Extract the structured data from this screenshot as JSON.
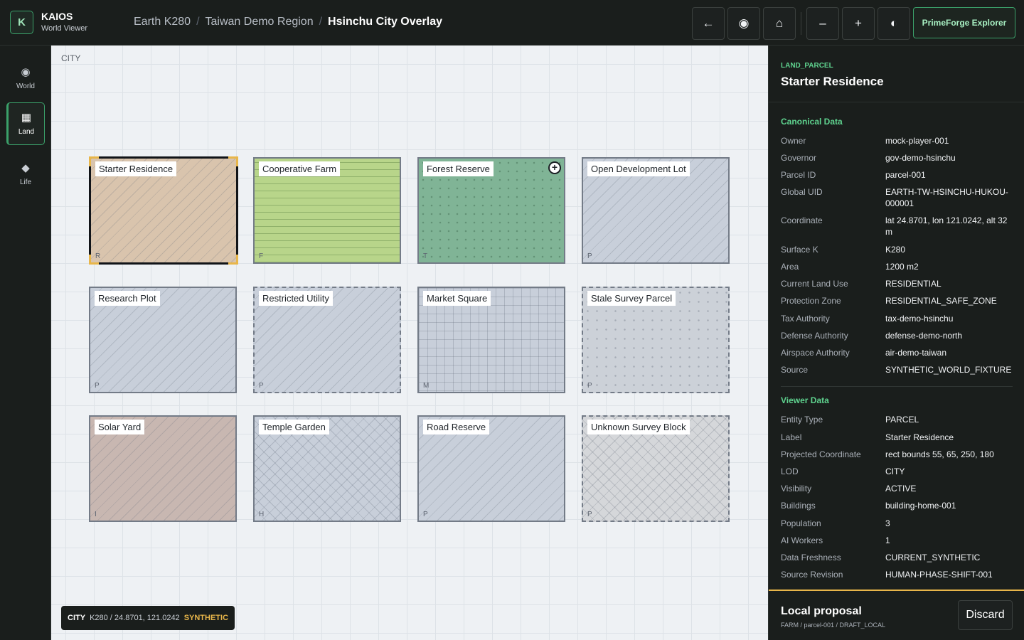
{
  "app": {
    "logo_letter": "K",
    "name": "KAIOS",
    "subtitle": "World Viewer"
  },
  "breadcrumb": [
    "Earth K280",
    "Taiwan Demo Region",
    "Hsinchu City Overlay"
  ],
  "toolbar": {
    "back_icon": "←",
    "target_icon": "◉",
    "home_icon": "⌂",
    "zoom_out_icon": "–",
    "zoom_in_icon": "+",
    "contrast_icon": "◐",
    "explorer_label": "PrimeForge Explorer"
  },
  "nav": [
    {
      "icon": "◉",
      "label": "World"
    },
    {
      "icon": "▦",
      "label": "Land"
    },
    {
      "icon": "◆",
      "label": "Life"
    }
  ],
  "canvas": {
    "lod_label": "CITY"
  },
  "parcels": [
    {
      "name": "Starter Residence",
      "code": "R",
      "color": "#d9c4ad",
      "selected": true
    },
    {
      "name": "Cooperative Farm",
      "code": "F",
      "color": "#b8d58a"
    },
    {
      "name": "Forest Reserve",
      "code": "T",
      "color": "#80b496",
      "badge": "+"
    },
    {
      "name": "Open Development Lot",
      "code": "P",
      "color": "#c8cfda"
    },
    {
      "name": "Research Plot",
      "code": "P",
      "color": "#c8cfda"
    },
    {
      "name": "Restricted Utility",
      "code": "P",
      "color": "#c8cfda"
    },
    {
      "name": "Market Square",
      "code": "M",
      "color": "#c8cfda"
    },
    {
      "name": "Stale Survey Parcel",
      "code": "P",
      "color": "#ccd1d8"
    },
    {
      "name": "Solar Yard",
      "code": "I",
      "color": "#c8b7b1"
    },
    {
      "name": "Temple Garden",
      "code": "H",
      "color": "#c8cfda"
    },
    {
      "name": "Road Reserve",
      "code": "P",
      "color": "#c8cfda"
    },
    {
      "name": "Unknown Survey Block",
      "code": "P",
      "color": "#d5d7da"
    }
  ],
  "status": {
    "lod": "CITY",
    "coords": "K280 / 24.8701, 121.0242",
    "tag": "SYNTHETIC"
  },
  "inspector": {
    "kind": "LAND_PARCEL",
    "title": "Starter Residence",
    "canonical_title": "Canonical Data",
    "canonical": [
      {
        "k": "Owner",
        "v": "mock-player-001"
      },
      {
        "k": "Governor",
        "v": "gov-demo-hsinchu"
      },
      {
        "k": "Parcel ID",
        "v": "parcel-001"
      },
      {
        "k": "Global UID",
        "v": "EARTH-TW-HSINCHU-HUKOU-000001"
      },
      {
        "k": "Coordinate",
        "v": "lat 24.8701, lon 121.0242, alt 32 m"
      },
      {
        "k": "Surface K",
        "v": "K280"
      },
      {
        "k": "Area",
        "v": "1200 m2"
      },
      {
        "k": "Current Land Use",
        "v": "RESIDENTIAL"
      },
      {
        "k": "Protection Zone",
        "v": "RESIDENTIAL_SAFE_ZONE"
      },
      {
        "k": "Tax Authority",
        "v": "tax-demo-hsinchu"
      },
      {
        "k": "Defense Authority",
        "v": "defense-demo-north"
      },
      {
        "k": "Airspace Authority",
        "v": "air-demo-taiwan"
      },
      {
        "k": "Source",
        "v": "SYNTHETIC_WORLD_FIXTURE"
      }
    ],
    "viewer_title": "Viewer Data",
    "viewer": [
      {
        "k": "Entity Type",
        "v": "PARCEL"
      },
      {
        "k": "Label",
        "v": "Starter Residence"
      },
      {
        "k": "Projected Coordinate",
        "v": "rect bounds 55, 65, 250, 180"
      },
      {
        "k": "LOD",
        "v": "CITY"
      },
      {
        "k": "Visibility",
        "v": "ACTIVE"
      },
      {
        "k": "Buildings",
        "v": "building-home-001"
      },
      {
        "k": "Population",
        "v": "3"
      },
      {
        "k": "AI Workers",
        "v": "1"
      },
      {
        "k": "Data Freshness",
        "v": "CURRENT_SYNTHETIC"
      },
      {
        "k": "Source Revision",
        "v": "HUMAN-PHASE-SHIFT-001"
      }
    ]
  },
  "proposal": {
    "title": "Local proposal",
    "subtitle": "FARM / parcel-001 / DRAFT_LOCAL",
    "discard_label": "Discard"
  }
}
